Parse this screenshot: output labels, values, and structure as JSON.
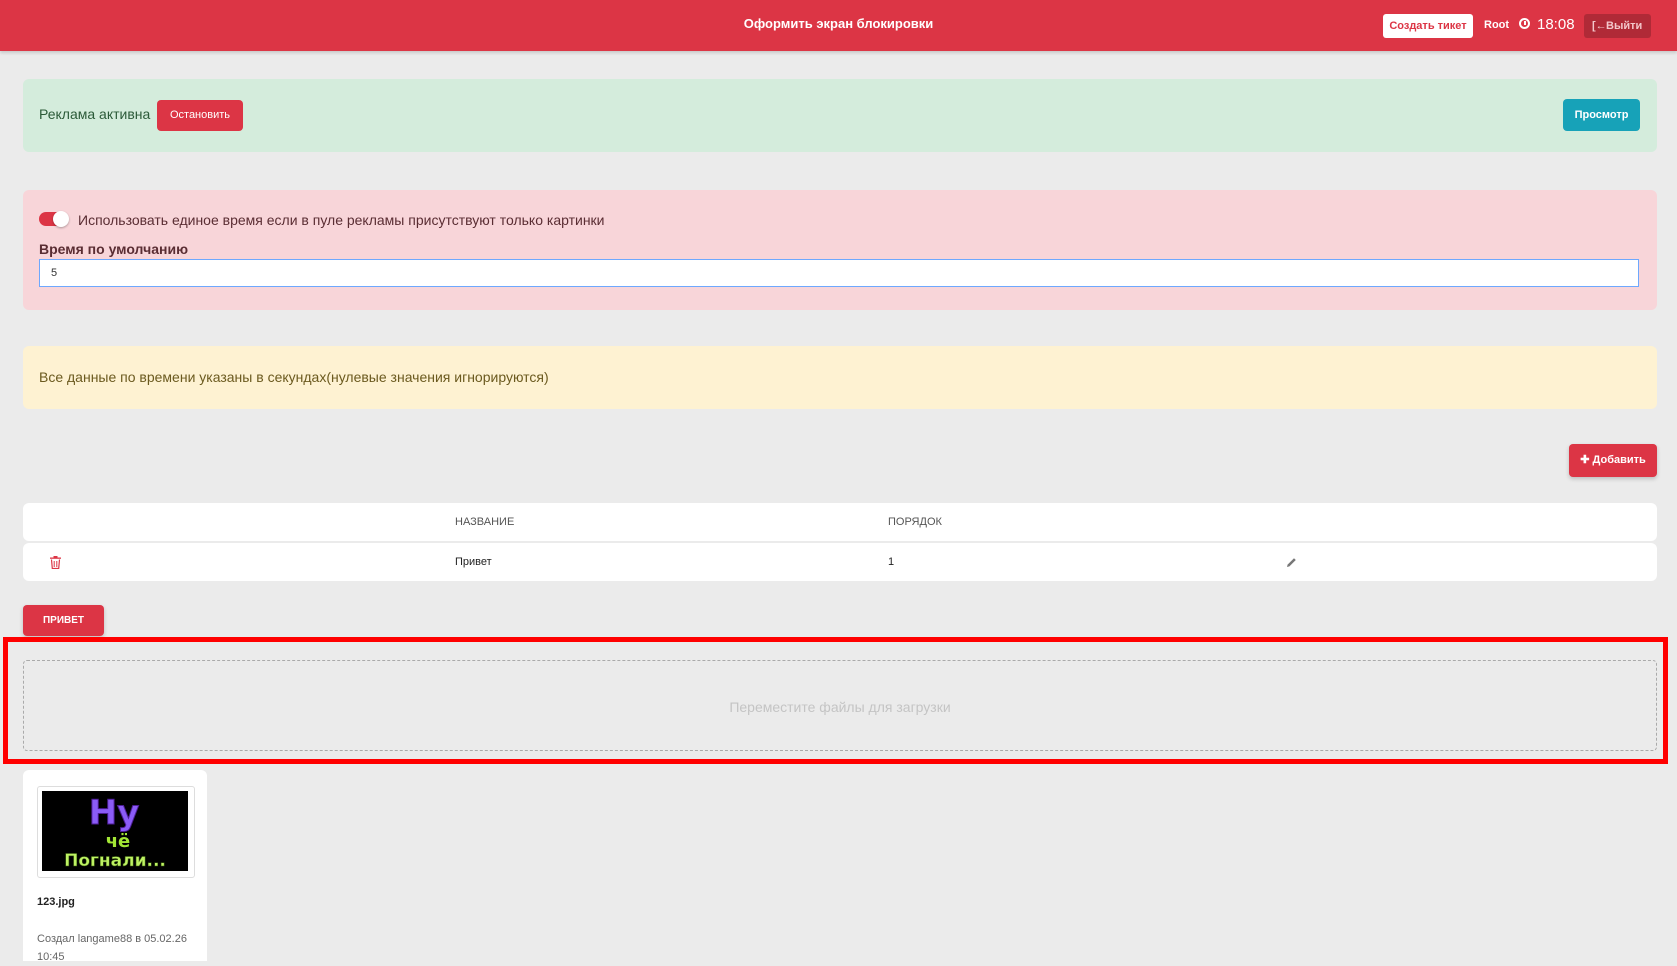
{
  "header": {
    "title": "Оформить экран блокировки",
    "ticket_button": "Создать тикет",
    "user": "Root",
    "time": "18:08",
    "logout_button": "Выйти",
    "accent": "#dc3545"
  },
  "ad_status": {
    "text": "Реклама активна",
    "stop_button": "Остановить",
    "preview_button": "Просмотр"
  },
  "settings": {
    "toggle_label": "Использовать единое время если в пуле рекламы присутствуют только картинки",
    "toggle_on": true,
    "default_time_label": "Время по умолчанию",
    "default_time_value": "5"
  },
  "note": {
    "text": "Все данные по времени указаны в секундах(нулевые значения игнорируются)"
  },
  "actions": {
    "add_button": "Добавить"
  },
  "table": {
    "columns": [
      "НАЗВАНИЕ",
      "ПОРЯДОК"
    ],
    "rows": [
      {
        "name": "Привет",
        "order": "1"
      }
    ]
  },
  "selected_tag": "ПРИВЕТ",
  "dropzone": {
    "text": "Переместите файлы для загрузки"
  },
  "files": [
    {
      "name": "123.jpg",
      "meta": "Создал langame88 в 05.02.26 10:45",
      "thumbnail_text": [
        "Ну",
        "чё",
        "Погнали..."
      ]
    }
  ]
}
